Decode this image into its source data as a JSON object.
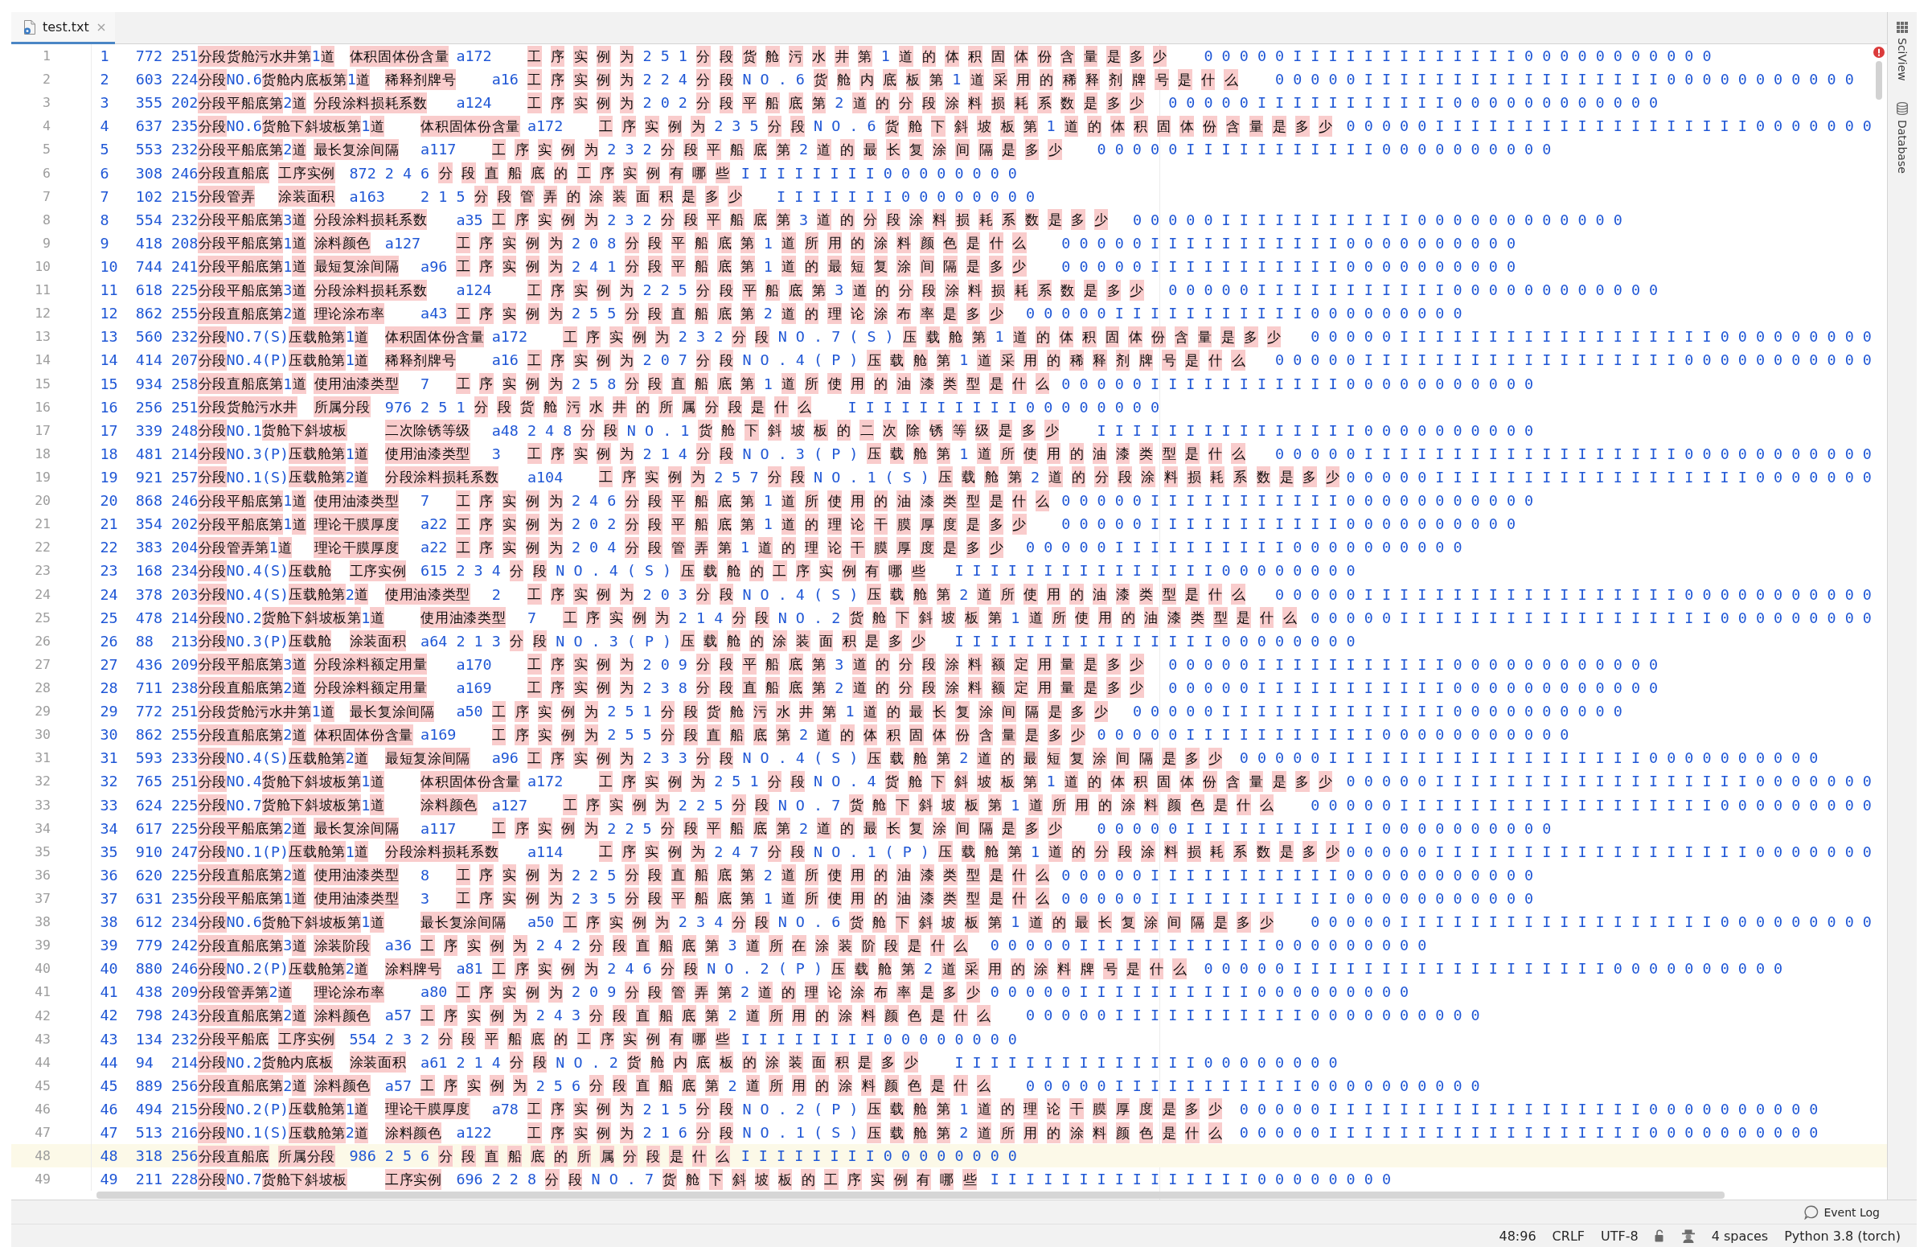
{
  "tabs": [
    {
      "label": "test.txt",
      "selected": true
    }
  ],
  "editor": {
    "lines": [
      {
        "number": "1",
        "current": false,
        "text": "1\t772\t251分段货舱污水井第1道\t体积固体份含量\ta172\t工 序 实 例 为 2 5 1 分 段 货 舱 污 水 井 第 1 道 的 体 积 固 体 份 含 量 是 多 少\t0 0 0 0 0 I I I I I I I I I I I I I 0 0 0 0 0 0 0 0 0 0 0"
      },
      {
        "number": "2",
        "current": false,
        "text": "2\t603\t224分段NO.6货舱内底板第1道\t稀释剂牌号\ta16\t工 序 实 例 为 2 2 4 分 段 N O . 6 货 舱 内 底 板 第 1 道 采 用 的 稀 释 剂 牌 号 是 什 么\t0 0 0 0 0 I I I I I I I I I I I I I I I I I 0 0 0 0 0 0 0 0 0 0 0"
      },
      {
        "number": "3",
        "current": false,
        "text": "3\t355\t202分段平船底第2道\t分段涂料损耗系数\ta124\t工 序 实 例 为 2 0 2 分 段 平 船 底 第 2 道 的 分 段 涂 料 损 耗 系 数 是 多 少\t0 0 0 0 0 I I I I I I I I I I I 0 0 0 0 0 0 0 0 0 0 0 0"
      },
      {
        "number": "4",
        "current": false,
        "text": "4\t637\t235分段NO.6货舱下斜坡板第1道\t体积固体份含量\ta172\t工 序 实 例 为 2 3 5 分 段 N O . 6 货 舱 下 斜 坡 板 第 1 道 的 体 积 固 体 份 含 量 是 多 少\t0 0 0 0 0 I I I I I I I I I I I I I I I I I I 0 0 0 0 0 0 0"
      },
      {
        "number": "5",
        "current": false,
        "text": "5\t553\t232分段平船底第2道\t最长复涂间隔\ta117\t工 序 实 例 为 2 3 2 分 段 平 船 底 第 2 道 的 最 长 复 涂 间 隔 是 多 少\t0 0 0 0 0 I I I I I I I I I I I 0 0 0 0 0 0 0 0 0 0"
      },
      {
        "number": "6",
        "current": false,
        "text": "6\t308\t246分段直船底\t工序实例\t872\t2 4 6 分 段 直 船 底 的 工 序 实 例 有 哪 些\tI I I I I I I I 0 0 0 0 0 0 0 0"
      },
      {
        "number": "7",
        "current": false,
        "text": "7\t102\t215分段管弄\t涂装面积\ta163\t2 1 5 分 段 管 弄 的 涂 装 面 积 是 多 少\tI I I I I I I 0 0 0 0 0 0 0 0"
      },
      {
        "number": "8",
        "current": false,
        "text": "8\t554\t232分段平船底第3道\t分段涂料损耗系数\ta35\t工 序 实 例 为 2 3 2 分 段 平 船 底 第 3 道 的 分 段 涂 料 损 耗 系 数 是 多 少\t0 0 0 0 0 I I I I I I I I I I I 0 0 0 0 0 0 0 0 0 0 0 0"
      },
      {
        "number": "9",
        "current": false,
        "text": "9\t418\t208分段平船底第1道\t涂料颜色\ta127\t工 序 实 例 为 2 0 8 分 段 平 船 底 第 1 道 所 用 的 涂 料 颜 色 是 什 么\t0 0 0 0 0 I I I I I I I I I I I 0 0 0 0 0 0 0 0 0 0"
      },
      {
        "number": "10",
        "current": false,
        "text": "10\t744\t241分段平船底第1道\t最短复涂间隔\ta96\t工 序 实 例 为 2 4 1 分 段 平 船 底 第 1 道 的 最 短 复 涂 间 隔 是 多 少\t0 0 0 0 0 I I I I I I I I I I I 0 0 0 0 0 0 0 0 0 0"
      },
      {
        "number": "11",
        "current": false,
        "text": "11\t618\t225分段平船底第3道\t分段涂料损耗系数\ta124\t工 序 实 例 为 2 2 5 分 段 平 船 底 第 3 道 的 分 段 涂 料 损 耗 系 数 是 多 少\t0 0 0 0 0 I I I I I I I I I I I 0 0 0 0 0 0 0 0 0 0 0 0"
      },
      {
        "number": "12",
        "current": false,
        "text": "12\t862\t255分段直船底第2道\t理论涂布率\ta43\t工 序 实 例 为 2 5 5 分 段 直 船 底 第 2 道 的 理 论 涂 布 率 是 多 少\t0 0 0 0 0 I I I I I I I I I I I 0 0 0 0 0 0 0 0 0"
      },
      {
        "number": "13",
        "current": false,
        "text": "13\t560\t232分段NO.7(S)压载舱第1道\t体积固体份含量\ta172\t工 序 实 例 为 2 3 2 分 段 N O . 7 ( S ) 压 载 舱 第 1 道 的 体 积 固 体 份 含 量 是 多 少\t0 0 0 0 0 I I I I I I I I I I I I I I I I I I 0 0 0 0 0 0 0 0 0"
      },
      {
        "number": "14",
        "current": false,
        "text": "14\t414\t207分段NO.4(P)压载舱第1道\t稀释剂牌号\ta16\t工 序 实 例 为 2 0 7 分 段 N O . 4 ( P ) 压 载 舱 第 1 道 采 用 的 稀 释 剂 牌 号 是 什 么\t0 0 0 0 0 I I I I I I I I I I I I I I I I I I 0 0 0 0 0 0 0 0 0 0 0"
      },
      {
        "number": "15",
        "current": false,
        "text": "15\t934\t258分段直船底第1道\t使用油漆类型\t7\t工 序 实 例 为 2 5 8 分 段 直 船 底 第 1 道 所 使 用 的 油 漆 类 型 是 什 么\t0 0 0 0 0 I I I I I I I I I I I 0 0 0 0 0 0 0 0 0 0 0"
      },
      {
        "number": "16",
        "current": false,
        "text": "16\t256\t251分段货舱污水井\t所属分段\t976\t2 5 1 分 段 货 舱 污 水 井 的 所 属 分 段 是 什 么\tI I I I I I I I I I 0 0 0 0 0 0 0 0"
      },
      {
        "number": "17",
        "current": false,
        "text": "17\t339\t248分段NO.1货舱下斜坡板\t二次除锈等级\ta48\t2 4 8 分 段 N O . 1 货 舱 下 斜 坡 板 的 二 次 除 锈 等 级 是 多 少\tI I I I I I I I I I I I I I I 0 0 0 0 0 0 0 0 0 0"
      },
      {
        "number": "18",
        "current": false,
        "text": "18\t481\t214分段NO.3(P)压载舱第1道\t使用油漆类型\t3\t工 序 实 例 为 2 1 4 分 段 N O . 3 ( P ) 压 载 舱 第 1 道 所 使 用 的 油 漆 类 型 是 什 么\t0 0 0 0 0 I I I I I I I I I I I I I I I I I I 0 0 0 0 0 0 0 0 0 0 0"
      },
      {
        "number": "19",
        "current": false,
        "text": "19\t921\t257分段NO.1(S)压载舱第2道\t分段涂料损耗系数\ta104\t工 序 实 例 为 2 5 7 分 段 N O . 1 ( S ) 压 载 舱 第 2 道 的 分 段 涂 料 损 耗 系 数 是 多 少\t0 0 0 0 0 I I I I I I I I I I I I I I I I I I 0 0 0 0 0 0 0"
      },
      {
        "number": "20",
        "current": false,
        "text": "20\t868\t246分段平船底第1道\t使用油漆类型\t7\t工 序 实 例 为 2 4 6 分 段 平 船 底 第 1 道 所 使 用 的 油 漆 类 型 是 什 么\t0 0 0 0 0 I I I I I I I I I I I 0 0 0 0 0 0 0 0 0 0 0"
      },
      {
        "number": "21",
        "current": false,
        "text": "21\t354\t202分段平船底第1道\t理论干膜厚度\ta22\t工 序 实 例 为 2 0 2 分 段 平 船 底 第 1 道 的 理 论 干 膜 厚 度 是 多 少\t0 0 0 0 0 I I I I I I I I I I I 0 0 0 0 0 0 0 0 0 0"
      },
      {
        "number": "22",
        "current": false,
        "text": "22\t383\t204分段管弄第1道\t理论干膜厚度\ta22\t工 序 实 例 为 2 0 4 分 段 管 弄 第 1 道 的 理 论 干 膜 厚 度 是 多 少\t0 0 0 0 0 I I I I I I I I I I 0 0 0 0 0 0 0 0 0 0"
      },
      {
        "number": "23",
        "current": false,
        "text": "23\t168\t234分段NO.4(S)压载舱\t工序实例\t615\t2 3 4 分 段 N O . 4 ( S ) 压 载 舱 的 工 序 实 例 有 哪 些\tI I I I I I I I I I I I I I I 0 0 0 0 0 0 0 0"
      },
      {
        "number": "24",
        "current": false,
        "text": "24\t378\t203分段NO.4(S)压载舱第2道\t使用油漆类型\t2\t工 序 实 例 为 2 0 3 分 段 N O . 4 ( S ) 压 载 舱 第 2 道 所 使 用 的 油 漆 类 型 是 什 么\t0 0 0 0 0 I I I I I I I I I I I I I I I I I I 0 0 0 0 0 0 0 0 0 0 0"
      },
      {
        "number": "25",
        "current": false,
        "text": "25\t478\t214分段NO.2货舱下斜坡板第1道\t使用油漆类型\t7\t工 序 实 例 为 2 1 4 分 段 N O . 2 货 舱 下 斜 坡 板 第 1 道 所 使 用 的 油 漆 类 型 是 什 么\t0 0 0 0 0 I I I I I I I I I I I I I I I I I I 0 0 0 0 0 0 0 0 0"
      },
      {
        "number": "26",
        "current": false,
        "text": "26\t88\t213分段NO.3(P)压载舱\t涂装面积\ta64\t2 1 3 分 段 N O . 3 ( P ) 压 载 舱 的 涂 装 面 积 是 多 少\tI I I I I I I I I I I I I I I 0 0 0 0 0 0 0 0"
      },
      {
        "number": "27",
        "current": false,
        "text": "27\t436\t209分段平船底第3道\t分段涂料额定用量\ta170\t工 序 实 例 为 2 0 9 分 段 平 船 底 第 3 道 的 分 段 涂 料 额 定 用 量 是 多 少\t0 0 0 0 0 I I I I I I I I I I I 0 0 0 0 0 0 0 0 0 0 0 0"
      },
      {
        "number": "28",
        "current": false,
        "text": "28\t711\t238分段直船底第2道\t分段涂料额定用量\ta169\t工 序 实 例 为 2 3 8 分 段 直 船 底 第 2 道 的 分 段 涂 料 额 定 用 量 是 多 少\t0 0 0 0 0 I I I I I I I I I I I 0 0 0 0 0 0 0 0 0 0 0 0"
      },
      {
        "number": "29",
        "current": false,
        "text": "29\t772\t251分段货舱污水井第1道\t最长复涂间隔\ta50\t工 序 实 例 为 2 5 1 分 段 货 舱 污 水 井 第 1 道 的 最 长 复 涂 间 隔 是 多 少\t0 0 0 0 0 I I I I I I I I I I I I I 0 0 0 0 0 0 0 0 0 0"
      },
      {
        "number": "30",
        "current": false,
        "text": "30\t862\t255分段直船底第2道\t体积固体份含量\ta169\t工 序 实 例 为 2 5 5 分 段 直 船 底 第 2 道 的 体 积 固 体 份 含 量 是 多 少\t0 0 0 0 0 I I I I I I I I I I I 0 0 0 0 0 0 0 0 0 0 0"
      },
      {
        "number": "31",
        "current": false,
        "text": "31\t593\t233分段NO.4(S)压载舱第2道\t最短复涂间隔\ta96\t工 序 实 例 为 2 3 3 分 段 N O . 4 ( S ) 压 载 舱 第 2 道 的 最 短 复 涂 间 隔 是 多 少\t0 0 0 0 0 I I I I I I I I I I I I I I I I I I 0 0 0 0 0 0 0 0 0 0"
      },
      {
        "number": "32",
        "current": false,
        "text": "32\t765\t251分段NO.4货舱下斜坡板第1道\t体积固体份含量\ta172\t工 序 实 例 为 2 5 1 分 段 N O . 4 货 舱 下 斜 坡 板 第 1 道 的 体 积 固 体 份 含 量 是 多 少\t0 0 0 0 0 I I I I I I I I I I I I I I I I I I 0 0 0 0 0 0 0"
      },
      {
        "number": "33",
        "current": false,
        "text": "33\t624\t225分段NO.7货舱下斜坡板第1道\t涂料颜色\ta127\t工 序 实 例 为 2 2 5 分 段 N O . 7 货 舱 下 斜 坡 板 第 1 道 所 用 的 涂 料 颜 色 是 什 么\t0 0 0 0 0 I I I I I I I I I I I I I I I I I I 0 0 0 0 0 0 0 0 0"
      },
      {
        "number": "34",
        "current": false,
        "text": "34\t617\t225分段平船底第2道\t最长复涂间隔\ta117\t工 序 实 例 为 2 2 5 分 段 平 船 底 第 2 道 的 最 长 复 涂 间 隔 是 多 少\t0 0 0 0 0 I I I I I I I I I I I 0 0 0 0 0 0 0 0 0 0"
      },
      {
        "number": "35",
        "current": false,
        "text": "35\t910\t247分段NO.1(P)压载舱第1道\t分段涂料损耗系数\ta114\t工 序 实 例 为 2 4 7 分 段 N O . 1 ( P ) 压 载 舱 第 1 道 的 分 段 涂 料 损 耗 系 数 是 多 少\t0 0 0 0 0 I I I I I I I I I I I I I I I I I I 0 0 0 0 0 0 0"
      },
      {
        "number": "36",
        "current": false,
        "text": "36\t620\t225分段直船底第2道\t使用油漆类型\t8\t工 序 实 例 为 2 2 5 分 段 直 船 底 第 2 道 所 使 用 的 油 漆 类 型 是 什 么\t0 0 0 0 0 I I I I I I I I I I I 0 0 0 0 0 0 0 0 0 0 0"
      },
      {
        "number": "37",
        "current": false,
        "text": "37\t631\t235分段平船底第1道\t使用油漆类型\t3\t工 序 实 例 为 2 3 5 分 段 平 船 底 第 1 道 所 使 用 的 油 漆 类 型 是 什 么\t0 0 0 0 0 I I I I I I I I I I I 0 0 0 0 0 0 0 0 0 0 0"
      },
      {
        "number": "38",
        "current": false,
        "text": "38\t612\t234分段NO.6货舱下斜坡板第1道\t最长复涂间隔\ta50\t工 序 实 例 为 2 3 4 分 段 N O . 6 货 舱 下 斜 坡 板 第 1 道 的 最 长 复 涂 间 隔 是 多 少\t0 0 0 0 0 I I I I I I I I I I I I I I I I I I 0 0 0 0 0 0 0 0 0"
      },
      {
        "number": "39",
        "current": false,
        "text": "39\t779\t242分段直船底第3道\t涂装阶段\ta36\t工 序 实 例 为 2 4 2 分 段 直 船 底 第 3 道 所 在 涂 装 阶 段 是 什 么\t0 0 0 0 0 I I I I I I I I I I I 0 0 0 0 0 0 0 0 0"
      },
      {
        "number": "40",
        "current": false,
        "text": "40\t880\t246分段NO.2(P)压载舱第2道\t涂料牌号\ta81\t工 序 实 例 为 2 4 6 分 段 N O . 2 ( P ) 压 载 舱 第 2 道 采 用 的 涂 料 牌 号 是 什 么\t0 0 0 0 0 I I I I I I I I I I I I I I I I I I 0 0 0 0 0 0 0 0 0 0"
      },
      {
        "number": "41",
        "current": false,
        "text": "41\t438\t209分段管弄第2道\t理论涂布率\ta80\t工 序 实 例 为 2 0 9 分 段 管 弄 第 2 道 的 理 论 涂 布 率 是 多 少\t0 0 0 0 0 I I I I I I I I I I 0 0 0 0 0 0 0 0 0"
      },
      {
        "number": "42",
        "current": false,
        "text": "42\t798\t243分段直船底第2道\t涂料颜色\ta57\t工 序 实 例 为 2 4 3 分 段 直 船 底 第 2 道 所 用 的 涂 料 颜 色 是 什 么\t0 0 0 0 0 I I I I I I I I I I I 0 0 0 0 0 0 0 0 0 0"
      },
      {
        "number": "43",
        "current": false,
        "text": "43\t134\t232分段平船底\t工序实例\t554\t2 3 2 分 段 平 船 底 的 工 序 实 例 有 哪 些\tI I I I I I I I 0 0 0 0 0 0 0 0"
      },
      {
        "number": "44",
        "current": false,
        "text": "44\t94\t214分段NO.2货舱内底板\t涂装面积\ta61\t2 1 4 分 段 N O . 2 货 舱 内 底 板 的 涂 装 面 积 是 多 少\tI I I I I I I I I I I I I I 0 0 0 0 0 0 0 0"
      },
      {
        "number": "45",
        "current": false,
        "text": "45\t889\t256分段直船底第2道\t涂料颜色\ta57\t工 序 实 例 为 2 5 6 分 段 直 船 底 第 2 道 所 用 的 涂 料 颜 色 是 什 么\t0 0 0 0 0 I I I I I I I I I I I 0 0 0 0 0 0 0 0 0 0"
      },
      {
        "number": "46",
        "current": false,
        "text": "46\t494\t215分段NO.2(P)压载舱第1道\t理论干膜厚度\ta78\t工 序 实 例 为 2 1 5 分 段 N O . 2 ( P ) 压 载 舱 第 1 道 的 理 论 干 膜 厚 度 是 多 少\t0 0 0 0 0 I I I I I I I I I I I I I I I I I I 0 0 0 0 0 0 0 0 0 0"
      },
      {
        "number": "47",
        "current": false,
        "text": "47\t513\t216分段NO.1(S)压载舱第2道\t涂料颜色\ta122\t工 序 实 例 为 2 1 6 分 段 N O . 1 ( S ) 压 载 舱 第 2 道 所 用 的 涂 料 颜 色 是 什 么\t0 0 0 0 0 I I I I I I I I I I I I I I I I I I 0 0 0 0 0 0 0 0 0 0"
      },
      {
        "number": "48",
        "current": true,
        "text": "48\t318\t256分段直船底\t所属分段\t986\t2 5 6 分 段 直 船 底 的 所 属 分 段 是 什 么\tI I I I I I I I 0 0 0 0 0 0 0 0"
      },
      {
        "number": "49",
        "current": false,
        "text": "49\t211\t228分段NO.7货舱下斜坡板\t工序实例\t696\t2 2 8 分 段 N O . 7 货 舱 下 斜 坡 板 的 工 序 实 例 有 哪 些\tI I I I I I I I I I I I I I I 0 0 0 0 0 0 0 0"
      }
    ]
  },
  "tool_strip": [
    {
      "kind": "plots",
      "label": "SciView"
    },
    {
      "kind": "database",
      "label": "Database"
    }
  ],
  "tool_window_bar": {
    "event_log": "Event Log"
  },
  "status_bar": {
    "caret_position": "48:96",
    "line_separator": "CRLF",
    "encoding": "UTF-8",
    "indent": "4 spaces",
    "interpreter": "Python 3.8 (torch)"
  }
}
